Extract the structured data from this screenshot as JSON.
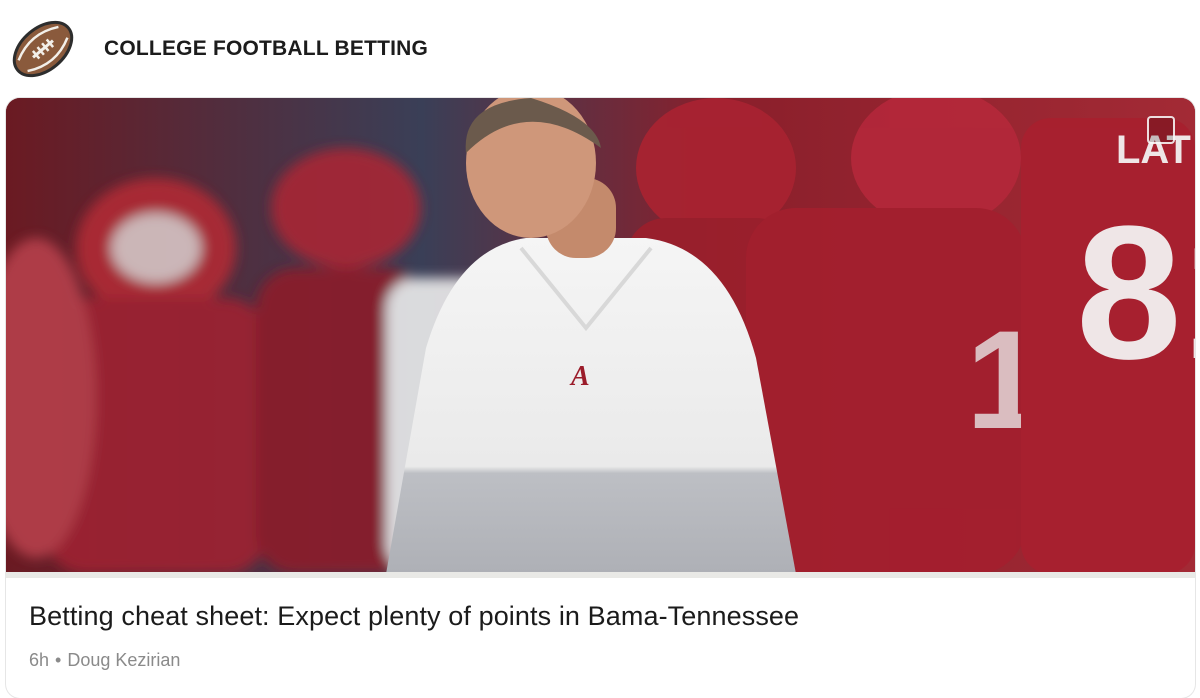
{
  "header": {
    "logo_icon": "football-icon",
    "title": "COLLEGE FOOTBALL BETTING"
  },
  "article": {
    "image_icon": "image-placeholder-icon",
    "headline": "Betting cheat sheet: Expect plenty of points in Bama-Tennessee",
    "age": "6h",
    "separator": "•",
    "author": "Doug Kezirian"
  },
  "colors": {
    "crimson": "#9b1c2a",
    "coach_jacket": "#f1f1f1",
    "meta_gray": "#8a8a8a"
  }
}
